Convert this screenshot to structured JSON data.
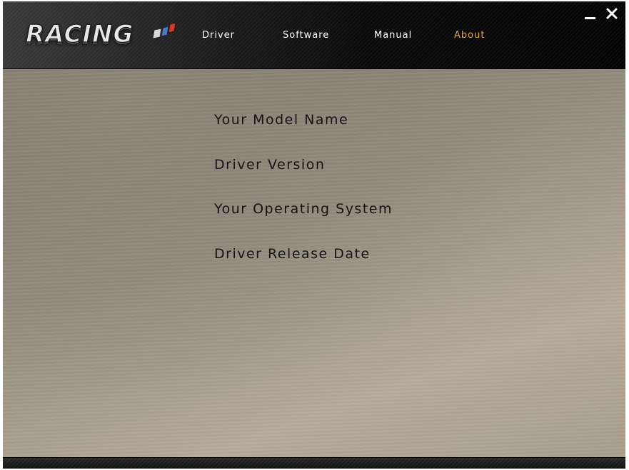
{
  "app": {
    "logo_text": "RACING"
  },
  "nav": {
    "items": [
      {
        "label": "Driver",
        "active": false
      },
      {
        "label": "Software",
        "active": false
      },
      {
        "label": "Manual",
        "active": false
      },
      {
        "label": "About",
        "active": true
      }
    ]
  },
  "window_controls": {
    "minimize_icon": "minimize-icon",
    "close_icon": "close-icon"
  },
  "about": {
    "items": [
      "Your Model Name",
      "Driver Version",
      "Your Operating System",
      "Driver Release Date"
    ]
  },
  "colors": {
    "active_tab": "#e5a53c",
    "nav_text": "#ffffff",
    "content_text": "#141414"
  }
}
